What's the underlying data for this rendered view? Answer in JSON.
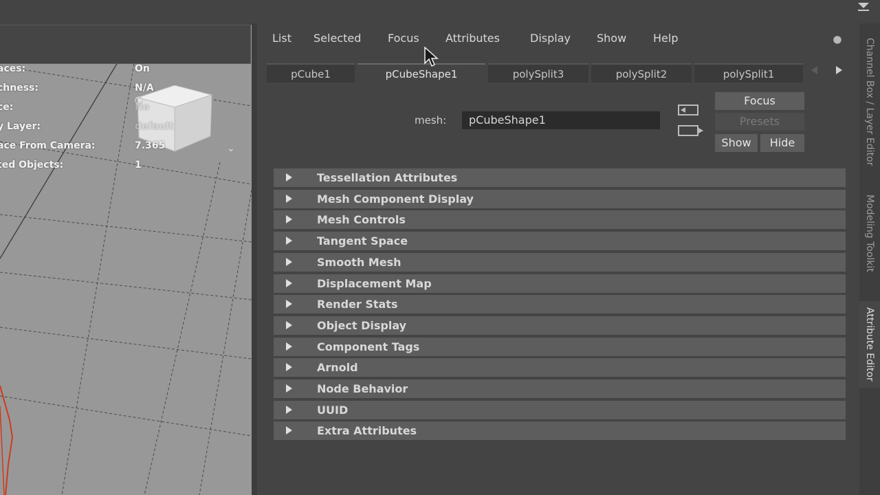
{
  "viewport": {
    "hud": [
      {
        "label": "aces:",
        "value": "On",
        "faded": false
      },
      {
        "label": "chness:",
        "value": "N/A",
        "faded": false
      },
      {
        "label": "ce:",
        "value": "No",
        "faded": true
      },
      {
        "label": "y Layer:",
        "value": "default",
        "faded": true
      },
      {
        "label": "ace From Camera:",
        "value": "7.365",
        "faded": false
      },
      {
        "label": "ted Objects:",
        "value": "1",
        "faded": false
      }
    ],
    "chevron_icon": "chevron-down-icon"
  },
  "menu": [
    "List",
    "Selected",
    "Focus",
    "Attributes",
    "Display",
    "Show",
    "Help"
  ],
  "node_tabs": [
    {
      "label": "pCube1",
      "active": false
    },
    {
      "label": "pCubeShape1",
      "active": true
    },
    {
      "label": "polySplit3",
      "active": false
    },
    {
      "label": "polySplit2",
      "active": false
    },
    {
      "label": "polySplit1",
      "active": false
    }
  ],
  "mesh": {
    "label": "mesh:",
    "value": "pCubeShape1"
  },
  "buttons": {
    "focus": "Focus",
    "presets": "Presets",
    "show": "Show",
    "hide": "Hide"
  },
  "sections": [
    "Tessellation Attributes",
    "Mesh Component Display",
    "Mesh Controls",
    "Tangent Space",
    "Smooth Mesh",
    "Displacement Map",
    "Render Stats",
    "Object Display",
    "Component Tags",
    "Arnold",
    "Node Behavior",
    "UUID",
    "Extra Attributes"
  ],
  "side_tabs": [
    {
      "label": "Channel Box / Layer Editor",
      "active": false
    },
    {
      "label": "Modeling Toolkit",
      "active": false
    },
    {
      "label": "Attribute Editor",
      "active": true
    }
  ],
  "icons": {
    "pin": "pin-icon",
    "cursor": "mouse-cursor-icon",
    "top_menu": "dropdown-arrow-icon"
  }
}
